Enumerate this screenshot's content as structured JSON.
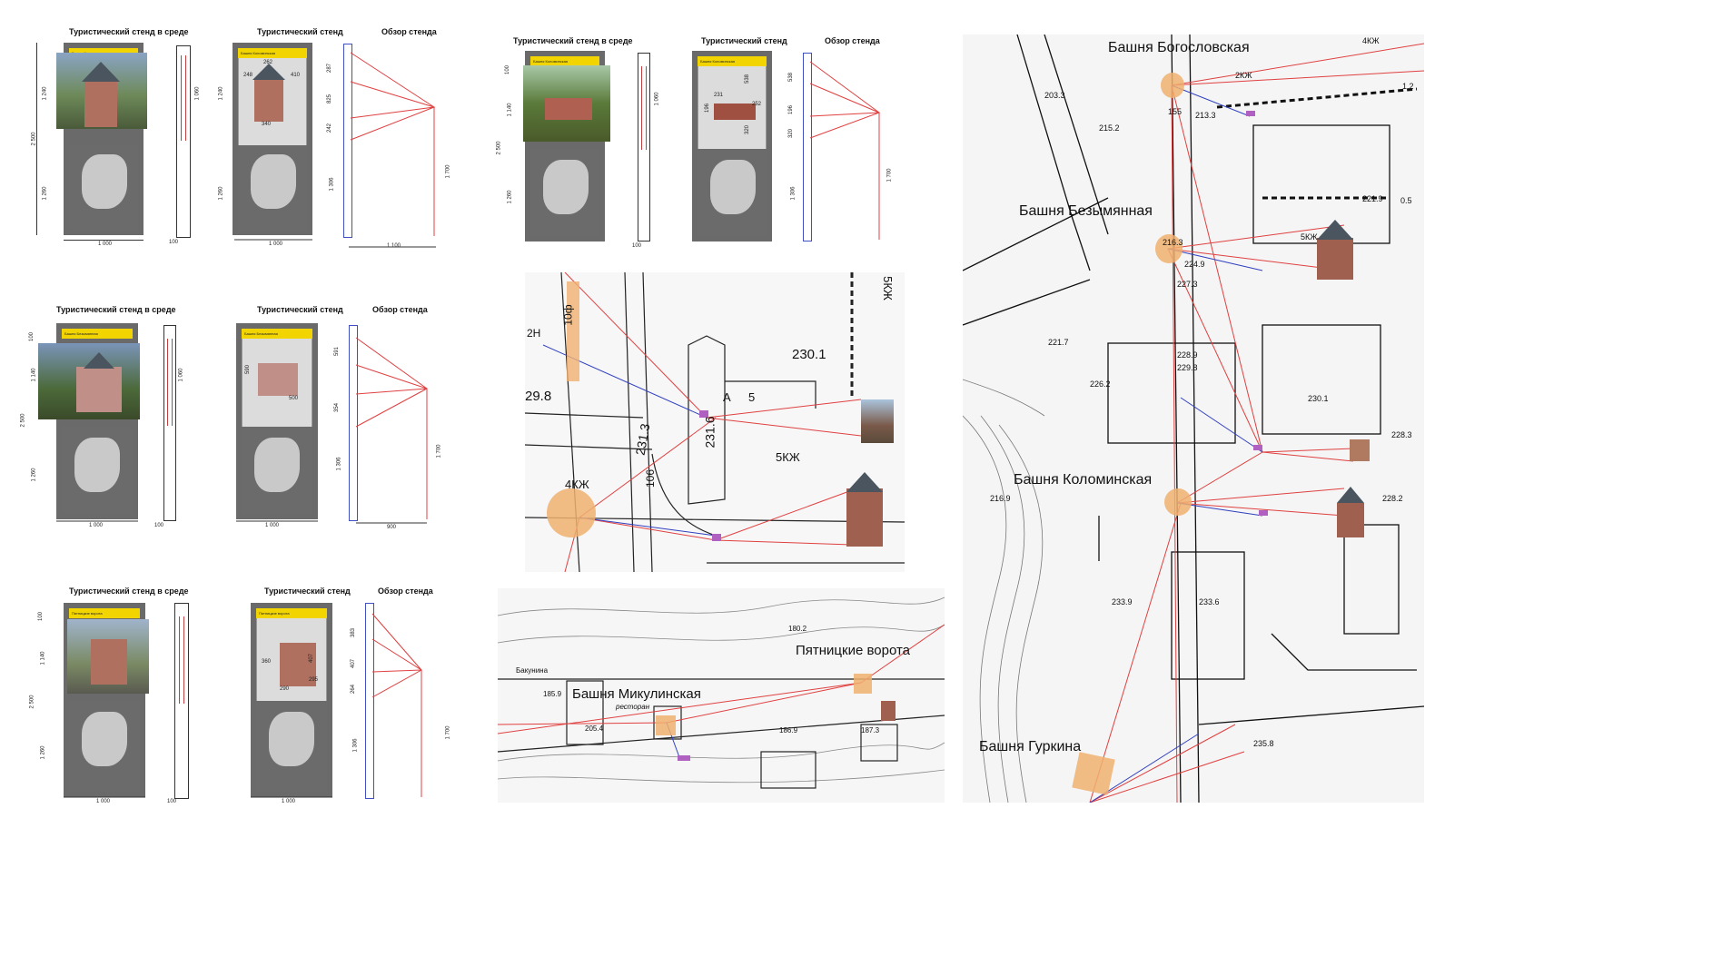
{
  "rows": [
    {
      "headings": {
        "env": "Туристический стенд в среде",
        "stand": "Туристический стенд",
        "review": "Обзор стенда"
      },
      "ybar_left": "Башня Коломинская",
      "ybar_right": "Башня Коломинская",
      "dims": [
        "1 240",
        "2 500",
        "1 260",
        "1 000",
        "100",
        "1 060",
        "40",
        "40",
        "262",
        "248",
        "410",
        "340",
        "287",
        "825",
        "242",
        "1 700",
        "1 306",
        "1 000",
        "1 100"
      ]
    },
    {
      "headings": {
        "env": "Туристический стенд в среде",
        "stand": "Туристический стенд",
        "review": "Обзор стенда"
      },
      "ybar_left": "Башня Безымянная",
      "ybar_right": "Башня Безымянная",
      "dims": [
        "100",
        "1 140",
        "2 500",
        "1 260",
        "1 000",
        "100",
        "1 060",
        "40",
        "40",
        "590",
        "500",
        "591",
        "354",
        "1 700",
        "1 306",
        "1 000",
        "900"
      ]
    },
    {
      "headings": {
        "env": "Туристический стенд в среде",
        "stand": "Туристический стенд",
        "review": "Обзор стенда"
      },
      "ybar_left": "Пятницкие ворота",
      "ybar_right": "Пятницкие ворота",
      "dims": [
        "100",
        "1 140",
        "2 500",
        "1 260",
        "1 000",
        "100",
        "360",
        "407",
        "295",
        "290",
        "383",
        "407",
        "264",
        "1 700",
        "1 306",
        "1 000"
      ]
    },
    {
      "headings": {
        "env": "Туристический стенд в среде",
        "stand": "Туристический стенд",
        "review": "Обзор стенда"
      },
      "ybar_left": "Башня Коломинская",
      "ybar_right": "Башня Коломинская",
      "dims": [
        "100",
        "1 140",
        "2 500",
        "1 260",
        "100",
        "1 060",
        "40",
        "538",
        "231",
        "196",
        "252",
        "320",
        "538",
        "196",
        "320",
        "1 700",
        "1 306"
      ]
    }
  ],
  "map_labels": {
    "bogoslovskaya": "Башня Богословская",
    "bezymyannaya": "Башня Безымянная",
    "kolominskaya": "Башня Коломинская",
    "gurkina": "Башня Гуркина",
    "mikulinskaya": "Башня Микулинская",
    "pyatnitskie": "Пятницкие ворота"
  },
  "detail_map_texts": [
    "230.1",
    "231.6",
    "231.3",
    "29.8",
    "5КЖ",
    "4КЖ",
    "5КЖ",
    "10ф",
    "2Н",
    "106",
    "A",
    "5"
  ],
  "big_map_texts": [
    "203.3",
    "215.2",
    "213.3",
    "155",
    "2КЖ",
    "4КЖ",
    "5КЖ",
    "216.3",
    "224.9",
    "227.3",
    "221.7",
    "226.2",
    "228.9",
    "229.8",
    "230.1",
    "228.3",
    "228.2",
    "216.9",
    "233.9",
    "233.6",
    "235.8",
    "221.9",
    "0.5",
    "1.2"
  ],
  "bottom_map_texts": [
    "185.9",
    "186.9",
    "187.3",
    "205.4",
    "Бакунина",
    "ресторан",
    "180.2"
  ],
  "colors": {
    "yellow": "#f2d500",
    "panel": "#6a6a6a",
    "sightline": "#e04040",
    "blueline": "#3040c0",
    "point": "#f0b070",
    "purple": "#b060c0"
  }
}
